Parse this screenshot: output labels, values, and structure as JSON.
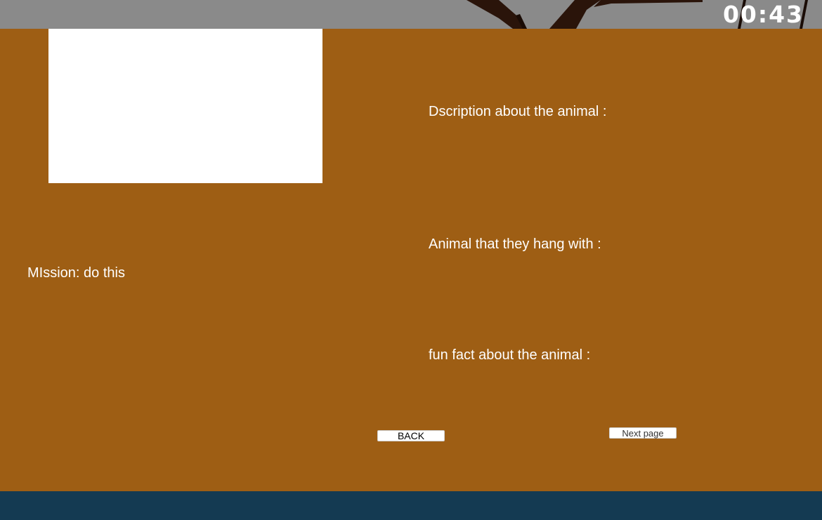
{
  "hud": {
    "timer": "00:43"
  },
  "info_page": {
    "mission": "MIssion: do this",
    "description_label": "Dscription about the animal :",
    "companions_label": "Animal that they hang with :",
    "fun_fact_label": "fun fact about the animal :"
  },
  "buttons": {
    "back": "BACK",
    "next": "Next page"
  },
  "colors": {
    "top_bar": "#8a8a8a",
    "panel": "#9e5e14",
    "image_box": "#ffffff",
    "bottom_strip": "#143a52",
    "branch": "#2a140a"
  }
}
